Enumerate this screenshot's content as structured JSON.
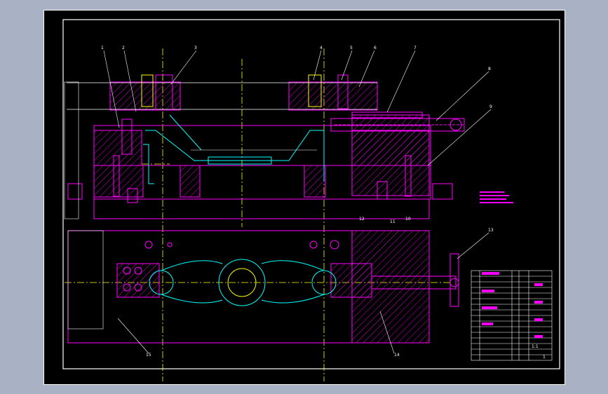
{
  "drawing": {
    "balloons": [
      "1",
      "2",
      "3",
      "4",
      "5",
      "6",
      "7",
      "8",
      "9",
      "10",
      "11",
      "12",
      "13",
      "14",
      "15"
    ],
    "colors": {
      "background": "#000000",
      "frame": "#ff00ff",
      "border": "#ffffff",
      "centerline": "#ffff00",
      "workpiece": "#00ffff",
      "section": "#ff00ff",
      "viewport_bg": "#a9b1c4"
    }
  },
  "title_block": {
    "scale": "1:1",
    "sheet": "1"
  }
}
